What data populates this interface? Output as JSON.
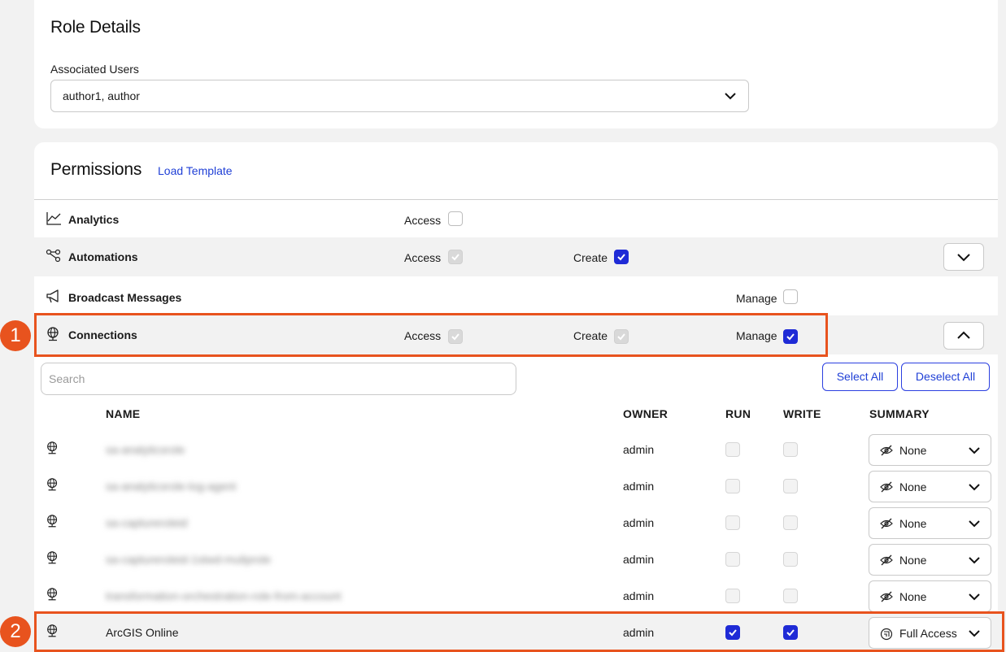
{
  "role_details": {
    "title": "Role Details",
    "associated_users_label": "Associated Users",
    "associated_users_value": "author1,  author"
  },
  "permissions": {
    "title": "Permissions",
    "load_template": "Load Template",
    "rows": [
      {
        "name": "Analytics",
        "icon": "chart-line-icon",
        "access_label": "Access"
      },
      {
        "name": "Automations",
        "icon": "workflow-icon",
        "access_label": "Access",
        "create_label": "Create"
      },
      {
        "name": "Broadcast Messages",
        "icon": "megaphone-icon",
        "manage_label": "Manage"
      },
      {
        "name": "Connections",
        "icon": "globe-icon",
        "access_label": "Access",
        "create_label": "Create",
        "manage_label": "Manage"
      }
    ]
  },
  "connections": {
    "search_placeholder": "Search",
    "select_all": "Select All",
    "deselect_all": "Deselect All",
    "columns": {
      "name": "NAME",
      "owner": "OWNER",
      "run": "RUN",
      "write": "WRITE",
      "summary": "SUMMARY"
    },
    "rows": [
      {
        "name": "sa-analyticsrole",
        "owner": "admin",
        "run": false,
        "write": false,
        "summary": "None",
        "blurred": true
      },
      {
        "name": "sa-analyticsrole-log-agent",
        "owner": "admin",
        "run": false,
        "write": false,
        "summary": "None",
        "blurred": true
      },
      {
        "name": "sa-captureroleid",
        "owner": "admin",
        "run": false,
        "write": false,
        "summary": "None",
        "blurred": true
      },
      {
        "name": "sa-captureroleid-1stwd-muliprole",
        "owner": "admin",
        "run": false,
        "write": false,
        "summary": "None",
        "blurred": true
      },
      {
        "name": "transformation-orchestration-role-from-account",
        "owner": "admin",
        "run": false,
        "write": false,
        "summary": "None",
        "blurred": true
      },
      {
        "name": "ArcGIS Online",
        "owner": "admin",
        "run": true,
        "write": true,
        "summary": "Full Access",
        "blurred": false
      }
    ]
  },
  "annotations": {
    "badge1": "1",
    "badge2": "2"
  },
  "colors": {
    "accent": "#1f2bd6",
    "highlight": "#e8531e",
    "link": "#1f3fd6"
  }
}
